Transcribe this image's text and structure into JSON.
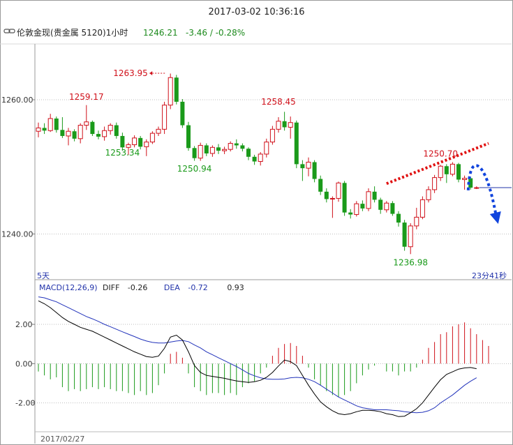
{
  "window": {
    "datetime": "2017-03-02 10:36:16"
  },
  "header": {
    "symbol_icon": "link-icon",
    "instrument": "伦敦金现",
    "market": "(贵金属 5120)",
    "period": "1小时",
    "last": "1246.21",
    "change": "-3.46 / -0.28%"
  },
  "colors": {
    "up": "#d0101a",
    "down": "#1a9a1a",
    "macd_line": "#000000",
    "signal_line": "#2233bb",
    "trend_dash": "#e01010",
    "arrow": "#1144dd",
    "grid": "#bdbdbd",
    "axis_text": "#333333"
  },
  "chart_data": [
    {
      "type": "candlestick",
      "name": "price",
      "ylim": [
        1233.5,
        1268
      ],
      "yticks": [
        1260.0,
        1240.0
      ],
      "ytick_labels": [
        "1260.00",
        "1240.00"
      ],
      "range_label": "5天",
      "countdown": "23分41秒",
      "candles": [
        [
          1255.3,
          1256.6,
          1254.4,
          1255.8
        ],
        [
          1255.8,
          1256.5,
          1254.9,
          1255.4
        ],
        [
          1255.4,
          1257.9,
          1255.2,
          1257.2
        ],
        [
          1257.2,
          1257.5,
          1255.1,
          1255.5
        ],
        [
          1255.5,
          1257.4,
          1254.3,
          1254.6
        ],
        [
          1254.6,
          1255.8,
          1253.2,
          1255.3
        ],
        [
          1255.3,
          1255.6,
          1253.8,
          1254.2
        ],
        [
          1254.2,
          1256.5,
          1253.5,
          1256.2
        ],
        [
          1256.2,
          1259.2,
          1255.5,
          1256.7
        ],
        [
          1256.7,
          1256.9,
          1254.6,
          1254.9
        ],
        [
          1254.9,
          1255.4,
          1254.1,
          1254.5
        ],
        [
          1254.5,
          1256.0,
          1253.9,
          1255.4
        ],
        [
          1255.4,
          1256.5,
          1254.8,
          1256.2
        ],
        [
          1256.2,
          1256.6,
          1254.2,
          1254.6
        ],
        [
          1254.6,
          1255.1,
          1252.4,
          1252.9
        ],
        [
          1252.9,
          1253.6,
          1251.8,
          1253.3
        ],
        [
          1253.3,
          1254.7,
          1252.9,
          1254.3
        ],
        [
          1254.3,
          1254.6,
          1252.6,
          1253.0
        ],
        [
          1253.0,
          1254.1,
          1251.6,
          1253.7
        ],
        [
          1253.7,
          1255.3,
          1253.4,
          1255.0
        ],
        [
          1255.0,
          1256.0,
          1254.6,
          1255.6
        ],
        [
          1255.6,
          1259.7,
          1254.9,
          1259.2
        ],
        [
          1259.2,
          1263.9,
          1258.6,
          1263.3
        ],
        [
          1263.3,
          1263.7,
          1259.3,
          1259.7
        ],
        [
          1259.7,
          1260.1,
          1255.8,
          1256.2
        ],
        [
          1256.2,
          1256.7,
          1252.4,
          1252.8
        ],
        [
          1252.8,
          1253.1,
          1250.9,
          1251.3
        ],
        [
          1251.3,
          1253.6,
          1250.9,
          1253.2
        ],
        [
          1253.2,
          1253.5,
          1251.6,
          1252.0
        ],
        [
          1252.0,
          1253.2,
          1251.5,
          1252.9
        ],
        [
          1252.9,
          1253.4,
          1251.9,
          1252.4
        ],
        [
          1252.4,
          1253.0,
          1251.9,
          1252.6
        ],
        [
          1252.6,
          1253.8,
          1252.3,
          1253.5
        ],
        [
          1253.5,
          1254.1,
          1252.7,
          1253.2
        ],
        [
          1253.2,
          1253.5,
          1252.3,
          1252.7
        ],
        [
          1252.7,
          1252.9,
          1251.0,
          1251.5
        ],
        [
          1251.5,
          1251.8,
          1250.3,
          1250.8
        ],
        [
          1250.8,
          1252.2,
          1250.2,
          1251.9
        ],
        [
          1251.9,
          1254.2,
          1251.4,
          1253.7
        ],
        [
          1253.7,
          1256.1,
          1253.3,
          1255.6
        ],
        [
          1255.6,
          1257.4,
          1255.1,
          1256.8
        ],
        [
          1256.8,
          1258.2,
          1255.4,
          1255.9
        ],
        [
          1255.9,
          1257.5,
          1254.2,
          1256.6
        ],
        [
          1256.6,
          1256.9,
          1249.8,
          1250.4
        ],
        [
          1250.4,
          1251.0,
          1247.9,
          1249.8
        ],
        [
          1249.8,
          1251.4,
          1248.6,
          1250.7
        ],
        [
          1250.7,
          1251.0,
          1247.7,
          1248.2
        ],
        [
          1248.2,
          1248.7,
          1245.8,
          1246.3
        ],
        [
          1246.3,
          1246.8,
          1244.7,
          1245.2
        ],
        [
          1245.2,
          1245.6,
          1242.4,
          1245.3
        ],
        [
          1245.3,
          1247.8,
          1244.8,
          1247.6
        ],
        [
          1247.6,
          1247.9,
          1242.7,
          1243.2
        ],
        [
          1243.2,
          1243.7,
          1242.3,
          1242.9
        ],
        [
          1242.9,
          1244.9,
          1242.6,
          1244.5
        ],
        [
          1244.5,
          1245.0,
          1243.4,
          1243.8
        ],
        [
          1243.8,
          1246.8,
          1243.4,
          1246.3
        ],
        [
          1246.3,
          1247.1,
          1244.7,
          1245.1
        ],
        [
          1245.1,
          1245.4,
          1243.0,
          1243.6
        ],
        [
          1243.6,
          1244.9,
          1243.2,
          1244.6
        ],
        [
          1244.6,
          1244.9,
          1242.7,
          1243.0
        ],
        [
          1243.0,
          1243.4,
          1241.1,
          1241.7
        ],
        [
          1241.7,
          1242.1,
          1237.5,
          1238.1
        ],
        [
          1238.1,
          1241.6,
          1237.0,
          1241.2
        ],
        [
          1241.2,
          1243.9,
          1240.7,
          1242.5
        ],
        [
          1242.5,
          1245.6,
          1242.2,
          1245.1
        ],
        [
          1245.1,
          1247.1,
          1244.7,
          1246.6
        ],
        [
          1246.6,
          1248.8,
          1246.1,
          1248.4
        ],
        [
          1248.4,
          1250.3,
          1247.9,
          1250.1
        ],
        [
          1250.1,
          1250.4,
          1247.6,
          1248.9
        ],
        [
          1248.9,
          1250.7,
          1248.6,
          1250.4
        ],
        [
          1250.4,
          1250.6,
          1247.7,
          1248.1
        ],
        [
          1248.1,
          1248.7,
          1246.6,
          1248.3
        ],
        [
          1248.3,
          1248.5,
          1246.6,
          1246.9
        ],
        [
          1246.9,
          1247.1,
          1246.7,
          1246.9
        ]
      ],
      "annotations": [
        {
          "text": "1263.95",
          "candle": 22,
          "price": 1263.95,
          "color": "red",
          "pointer": true
        },
        {
          "text": "1259.17",
          "candle": 8,
          "price": 1259.17,
          "color": "red"
        },
        {
          "text": "1258.45",
          "candle": 40,
          "price": 1258.45,
          "color": "red"
        },
        {
          "text": "1253.34",
          "candle": 14,
          "price": 1253.34,
          "color": "green"
        },
        {
          "text": "1250.94",
          "candle": 26,
          "price": 1250.94,
          "color": "green"
        },
        {
          "text": "1250.70",
          "candle": 67,
          "price": 1250.7,
          "color": "red"
        },
        {
          "text": "1236.98",
          "candle": 62,
          "price": 1236.98,
          "color": "green"
        }
      ],
      "trendline": {
        "from": [
          58,
          1247.5
        ],
        "to": [
          75,
          1253.5
        ],
        "style": "dotted",
        "color": "red"
      },
      "forecast_arrow": {
        "description": "dotted blue arrow pointing down",
        "from_candle": 73,
        "from_price": 1249.3,
        "to_price": 1241.5
      },
      "last_price_tick": 1246.9
    },
    {
      "type": "macd",
      "name": "MACD",
      "params_label": "MACD(12,26,9)",
      "diff_label": "DIFF",
      "diff_value": "-0.26",
      "dea_label": "DEA",
      "dea_value": "-0.72",
      "macd_value": "0.93",
      "ylim": [
        -3.4,
        3.6
      ],
      "yticks": [
        2.0,
        0.0,
        -2.0
      ],
      "ytick_labels": [
        "2.00",
        "0.00",
        "-2.00"
      ],
      "date_label": "2017/02/27",
      "diff": [
        3.2,
        3.05,
        2.85,
        2.6,
        2.35,
        2.15,
        2.0,
        1.85,
        1.75,
        1.65,
        1.5,
        1.35,
        1.2,
        1.05,
        0.9,
        0.75,
        0.6,
        0.48,
        0.36,
        0.32,
        0.38,
        0.78,
        1.35,
        1.45,
        1.2,
        0.6,
        -0.1,
        -0.45,
        -0.6,
        -0.65,
        -0.7,
        -0.75,
        -0.82,
        -0.88,
        -0.92,
        -0.96,
        -0.92,
        -0.85,
        -0.7,
        -0.45,
        -0.12,
        0.18,
        0.1,
        -0.1,
        -0.6,
        -1.1,
        -1.55,
        -1.95,
        -2.2,
        -2.4,
        -2.55,
        -2.6,
        -2.55,
        -2.45,
        -2.38,
        -2.38,
        -2.4,
        -2.45,
        -2.55,
        -2.6,
        -2.7,
        -2.68,
        -2.5,
        -2.3,
        -2.0,
        -1.6,
        -1.2,
        -0.82,
        -0.55,
        -0.42,
        -0.28,
        -0.22,
        -0.2,
        -0.26
      ],
      "dea": [
        3.4,
        3.35,
        3.25,
        3.15,
        3.0,
        2.85,
        2.7,
        2.55,
        2.4,
        2.28,
        2.15,
        2.0,
        1.88,
        1.75,
        1.62,
        1.5,
        1.38,
        1.25,
        1.15,
        1.08,
        1.05,
        1.05,
        1.1,
        1.15,
        1.18,
        1.12,
        0.95,
        0.8,
        0.6,
        0.45,
        0.3,
        0.15,
        0.0,
        -0.15,
        -0.32,
        -0.5,
        -0.62,
        -0.72,
        -0.78,
        -0.8,
        -0.8,
        -0.78,
        -0.72,
        -0.7,
        -0.72,
        -0.8,
        -0.92,
        -1.1,
        -1.3,
        -1.5,
        -1.7,
        -1.85,
        -2.0,
        -2.15,
        -2.25,
        -2.3,
        -2.35,
        -2.35,
        -2.35,
        -2.38,
        -2.4,
        -2.45,
        -2.48,
        -2.5,
        -2.48,
        -2.4,
        -2.25,
        -2.0,
        -1.8,
        -1.6,
        -1.35,
        -1.1,
        -0.9,
        -0.72
      ],
      "histogram": [
        -0.4,
        -0.6,
        -0.8,
        -0.7,
        -1.2,
        -1.4,
        -1.3,
        -1.4,
        -1.3,
        -1.2,
        -1.3,
        -1.2,
        -1.3,
        -1.4,
        -1.4,
        -1.5,
        -1.6,
        -1.4,
        -1.6,
        -1.5,
        -1.1,
        -0.5,
        0.5,
        0.6,
        0.3,
        -0.5,
        -1.2,
        -1.4,
        -1.6,
        -1.5,
        -1.5,
        -1.6,
        -1.5,
        -1.6,
        -1.2,
        -1.0,
        -0.9,
        -0.5,
        -0.2,
        0.4,
        0.8,
        1.0,
        1.05,
        0.9,
        0.4,
        -0.2,
        -0.8,
        -1.1,
        -1.4,
        -1.6,
        -1.7,
        -1.6,
        -1.4,
        -1.0,
        -0.6,
        -0.3,
        -0.1,
        0.0,
        -0.4,
        -0.4,
        -0.6,
        -0.4,
        -0.4,
        -0.2,
        0.2,
        0.8,
        1.1,
        1.5,
        1.6,
        1.9,
        2.0,
        2.1,
        1.8,
        1.5,
        1.2,
        0.9
      ]
    }
  ]
}
